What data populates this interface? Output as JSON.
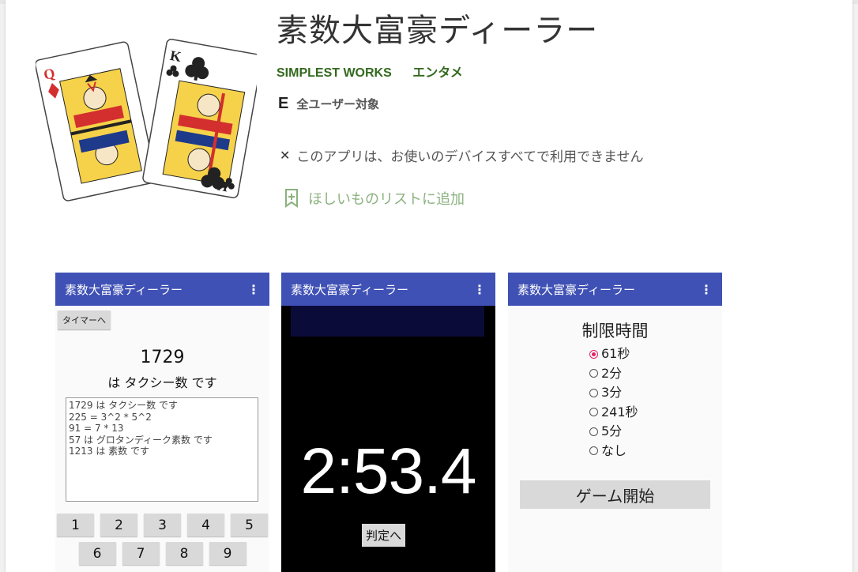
{
  "app": {
    "title": "素数大富豪ディーラー",
    "developer": "SIMPLEST WORKS",
    "category": "エンタメ",
    "rating_label": "全ユーザー対象",
    "compat_text": "このアプリは、お使いのデバイスすべてで利用できません",
    "wishlist_label": "ほしいものリストに追加"
  },
  "colors": {
    "accent_green": "#33691e",
    "appbar_blue": "#3f51b5",
    "radio_pink": "#e91e63"
  },
  "screens": [
    {
      "appbar_title": "素数大富豪ディーラー",
      "menu_icon": "⋮",
      "timer_button": "タイマーへ",
      "number": "1729",
      "result": "は タクシー数 です",
      "log": [
        "1729 は タクシー数 です",
        "225 = 3^2 * 5^2",
        "91 = 7 * 13",
        "57 は グロタンディーク素数 です",
        "1213 は 素数 です"
      ],
      "keys_row1": [
        "1",
        "2",
        "3",
        "4",
        "5"
      ],
      "keys_row2": [
        "6",
        "7",
        "8",
        "9"
      ]
    },
    {
      "appbar_title": "素数大富豪ディーラー",
      "menu_icon": "⋮",
      "clock": "2:53.4",
      "judge_button": "判定へ"
    },
    {
      "appbar_title": "素数大富豪ディーラー",
      "menu_icon": "⋮",
      "heading": "制限時間",
      "options": [
        "61秒",
        "2分",
        "3分",
        "241秒",
        "5分",
        "なし"
      ],
      "selected_option": "61秒",
      "start_button": "ゲーム開始"
    }
  ]
}
